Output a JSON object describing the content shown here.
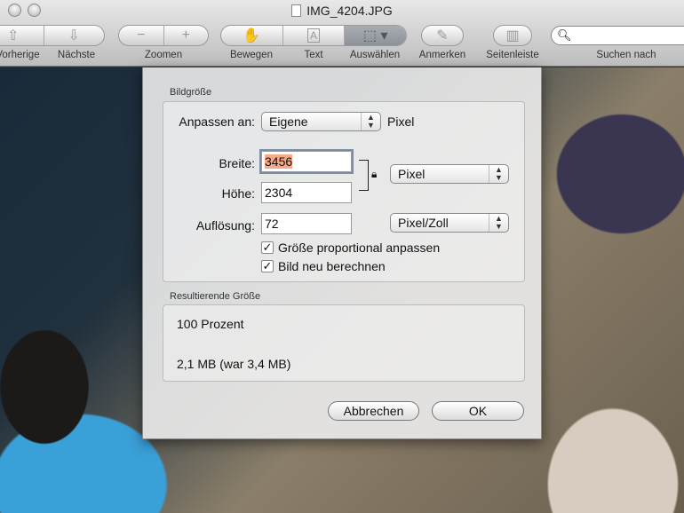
{
  "window": {
    "title": "IMG_4204.JPG"
  },
  "toolbar": {
    "prev": "Vorherige",
    "next": "Nächste",
    "zoom": "Zoomen",
    "move": "Bewegen",
    "text": "Text",
    "select": "Auswählen",
    "annotate": "Anmerken",
    "sidebar": "Seitenleiste",
    "search": "Suchen nach",
    "search_placeholder": ""
  },
  "dialog": {
    "size_group": "Bildgröße",
    "fit_label": "Anpassen an:",
    "fit_value": "Eigene",
    "fit_unit": "Pixel",
    "width_label": "Breite:",
    "width_value": "3456",
    "height_label": "Höhe:",
    "height_value": "2304",
    "size_unit": "Pixel",
    "res_label": "Auflösung:",
    "res_value": "72",
    "res_unit": "Pixel/Zoll",
    "proportional": "Größe proportional anpassen",
    "resample": "Bild neu berechnen",
    "result_group": "Resultierende Größe",
    "percent": "100 Prozent",
    "filesize": "2,1 MB (war 3,4 MB)",
    "cancel": "Abbrechen",
    "ok": "OK"
  }
}
